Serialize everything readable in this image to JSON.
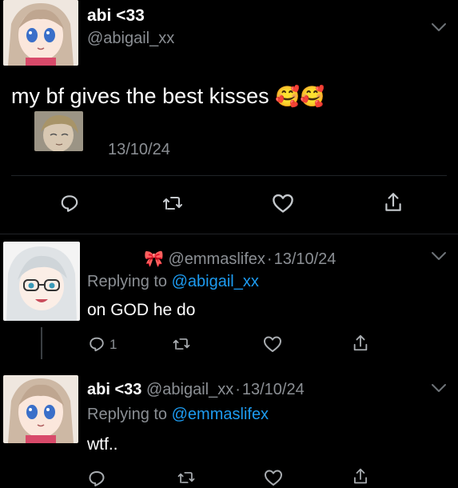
{
  "main_tweet": {
    "display_name": "abi <33",
    "handle": "@abigail_xx",
    "text": "my bf gives the best kisses",
    "emoji": "🥰🥰",
    "date": "13/10/24"
  },
  "reply_1": {
    "bow": "🎀",
    "author": "@emmaslifex",
    "sep": "·",
    "date": "13/10/24",
    "replying_prefix": "Replying to",
    "replying_handle": "@abigail_xx",
    "text": "on GOD he do",
    "reply_count": "1"
  },
  "reply_2": {
    "display_name": "abi <33",
    "handle": "@abigail_xx",
    "sep": "·",
    "date": "13/10/24",
    "replying_prefix": "Replying to",
    "replying_handle": "@emmaslifex",
    "text": "wtf.."
  },
  "icons": [
    "reply-icon",
    "retweet-icon",
    "like-icon",
    "share-icon",
    "chevron-down-icon"
  ],
  "colors": {
    "background": "#000000",
    "muted": "#8b8f94",
    "link": "#1d9bf0",
    "bow": "#ff7aa6"
  }
}
